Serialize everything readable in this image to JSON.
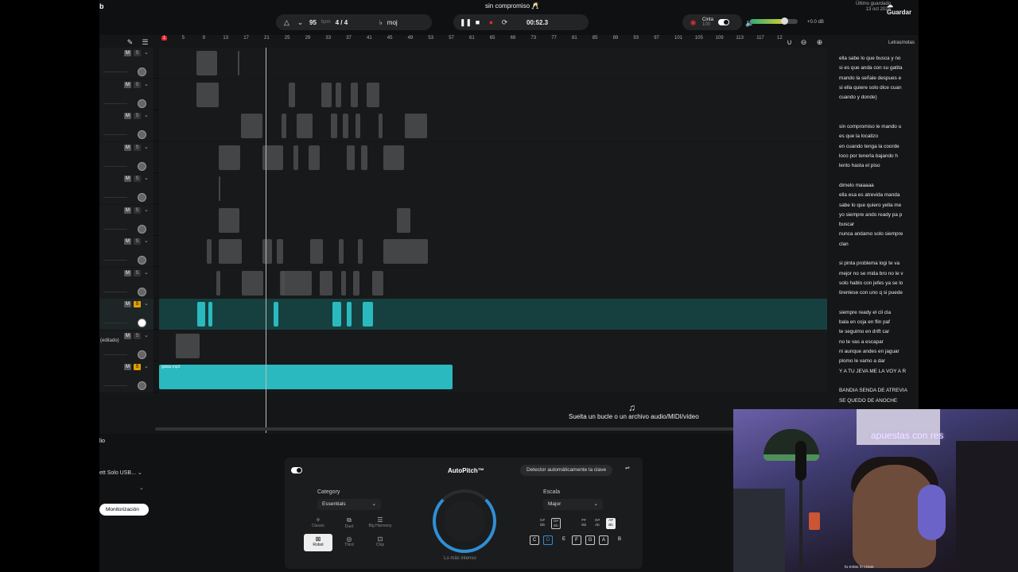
{
  "window": {
    "corner_letter": "b"
  },
  "header": {
    "song_title": "sin compromiso 🥂",
    "tempo": {
      "bpm": "95",
      "unit": "bpm",
      "time_signature": "4 / 4",
      "key": "moj"
    },
    "transport": {
      "time": "00:52.3"
    },
    "cinta": {
      "label": "Cinta",
      "value": "100"
    },
    "master_db": "+0.0 dB",
    "last_save": {
      "label": "Último guardado",
      "date": "13 oct 2025"
    },
    "save_label": "Guardar"
  },
  "ruler": {
    "bars": [
      "1",
      "5",
      "9",
      "13",
      "17",
      "21",
      "25",
      "29",
      "33",
      "37",
      "41",
      "45",
      "49",
      "53",
      "57",
      "61",
      "65",
      "69",
      "73",
      "77",
      "81",
      "85",
      "89",
      "93",
      "97",
      "101",
      "105",
      "109",
      "113",
      "117",
      "12"
    ]
  },
  "tracks": [
    {
      "name": "",
      "selected": false,
      "solo": false
    },
    {
      "name": "",
      "selected": false,
      "solo": false
    },
    {
      "name": "",
      "selected": false,
      "solo": false
    },
    {
      "name": "",
      "selected": false,
      "solo": false
    },
    {
      "name": "",
      "selected": false,
      "solo": false
    },
    {
      "name": "",
      "selected": false,
      "solo": false
    },
    {
      "name": "",
      "selected": false,
      "solo": false
    },
    {
      "name": "",
      "selected": false,
      "solo": false
    },
    {
      "name": "",
      "selected": true,
      "solo": true
    },
    {
      "name": "(editado)",
      "selected": false,
      "solo": false
    },
    {
      "name": "",
      "selected": false,
      "solo": true,
      "clip_label": "gatas.mp3"
    }
  ],
  "drop_zone": {
    "text": "Suelta un bucle o un archivo audio/MIDI/vídeo"
  },
  "lyrics": {
    "title": "Letras/notas",
    "lines": [
      "ella sabe lo que busca y no",
      "si es que anda con su gatita",
      "mando la señale despues e",
      "si ella quiere solo dice cuan",
      "cuando y donde)",
      "",
      "",
      "sin compromiso  le mando u",
      "es que la localizo",
      " en cuando tenga la coorde",
      " loco por  tenerla bajando h",
      "lento hasta el piso",
      "",
      "dimelo  maaaaa",
      "ella esa es atrevida manda",
      "sabe lo que quiero  yella me",
      "yo siempre ando ready pa p",
      "buscar",
      "nunca andamo solo siempre",
      "clan",
      "",
      "si pinta problema logi te va",
      "mejor no se mida bro no le v",
      "solo hablo con jefes ya se lo",
      " tirenlese con uno q si puede",
      "",
      "siempre ready el cli cla",
      "bala en coja en flin paf",
      "te  seguimo en drift car",
      "no te vas a escapar",
      "ni aunque andes en jaguar",
      "plomo le vamo a dar",
      "Y A TU JEVA ME LA VOY A R",
      "",
      "BANDIA SENDA DE  ATREVIA",
      "SE QUEDO DE ANOCHE"
    ]
  },
  "bottom": {
    "panel_label": "lio",
    "input_device": "ett Solo USB...",
    "monitor_label": "Monitorización",
    "autopitch": {
      "title": "AutoPitch™",
      "detect_label": "Detector automáticamente la clave",
      "category_label": "Category",
      "category_value": "Essentials",
      "presets": [
        "Classic",
        "Duet",
        "Big Harmony",
        "Robot",
        "Third",
        "Chip"
      ],
      "dial_label": "Lo más intenso",
      "scale_label": "Escala",
      "scale_value": "Major",
      "sharps": [
        "C#\nDb",
        "D#\nEb",
        "F#\nGb",
        "G#\nAb",
        "A#\nBb"
      ],
      "naturals": [
        "C",
        "D",
        "E",
        "F",
        "G",
        "A",
        "B"
      ]
    }
  },
  "webcam": {
    "neon_text": "apuestas con res",
    "caption": "tu estas lo creas"
  }
}
